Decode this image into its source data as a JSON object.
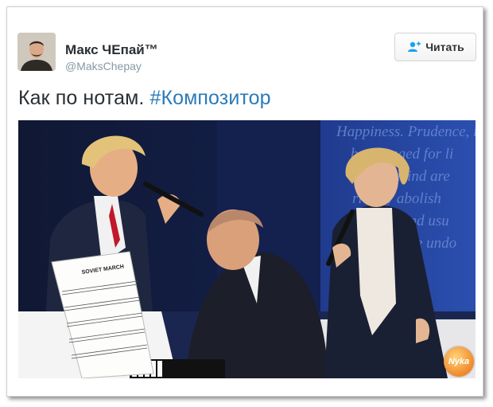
{
  "tweet": {
    "author": {
      "display_name": "Макс ЧЕпай™",
      "handle": "@MaksChepay"
    },
    "follow_button": {
      "label": "Читать",
      "icon": "add-user-icon"
    },
    "text": {
      "main": "Как по нотам.",
      "hashtag": "#Композитор"
    },
    "media": {
      "sheet_music_title": "SOVIET MARCH",
      "backdrop_text": [
        "Happiness. Prudence, in",
        "be changed for li",
        "ent mankind are",
        "ries by abolish",
        "s and usu",
        "e undo"
      ],
      "watermark": "Nyka"
    }
  },
  "colors": {
    "text": "#292f33",
    "muted": "#8899a6",
    "link": "#2b7bb9",
    "card_border": "#cfcfcf"
  }
}
